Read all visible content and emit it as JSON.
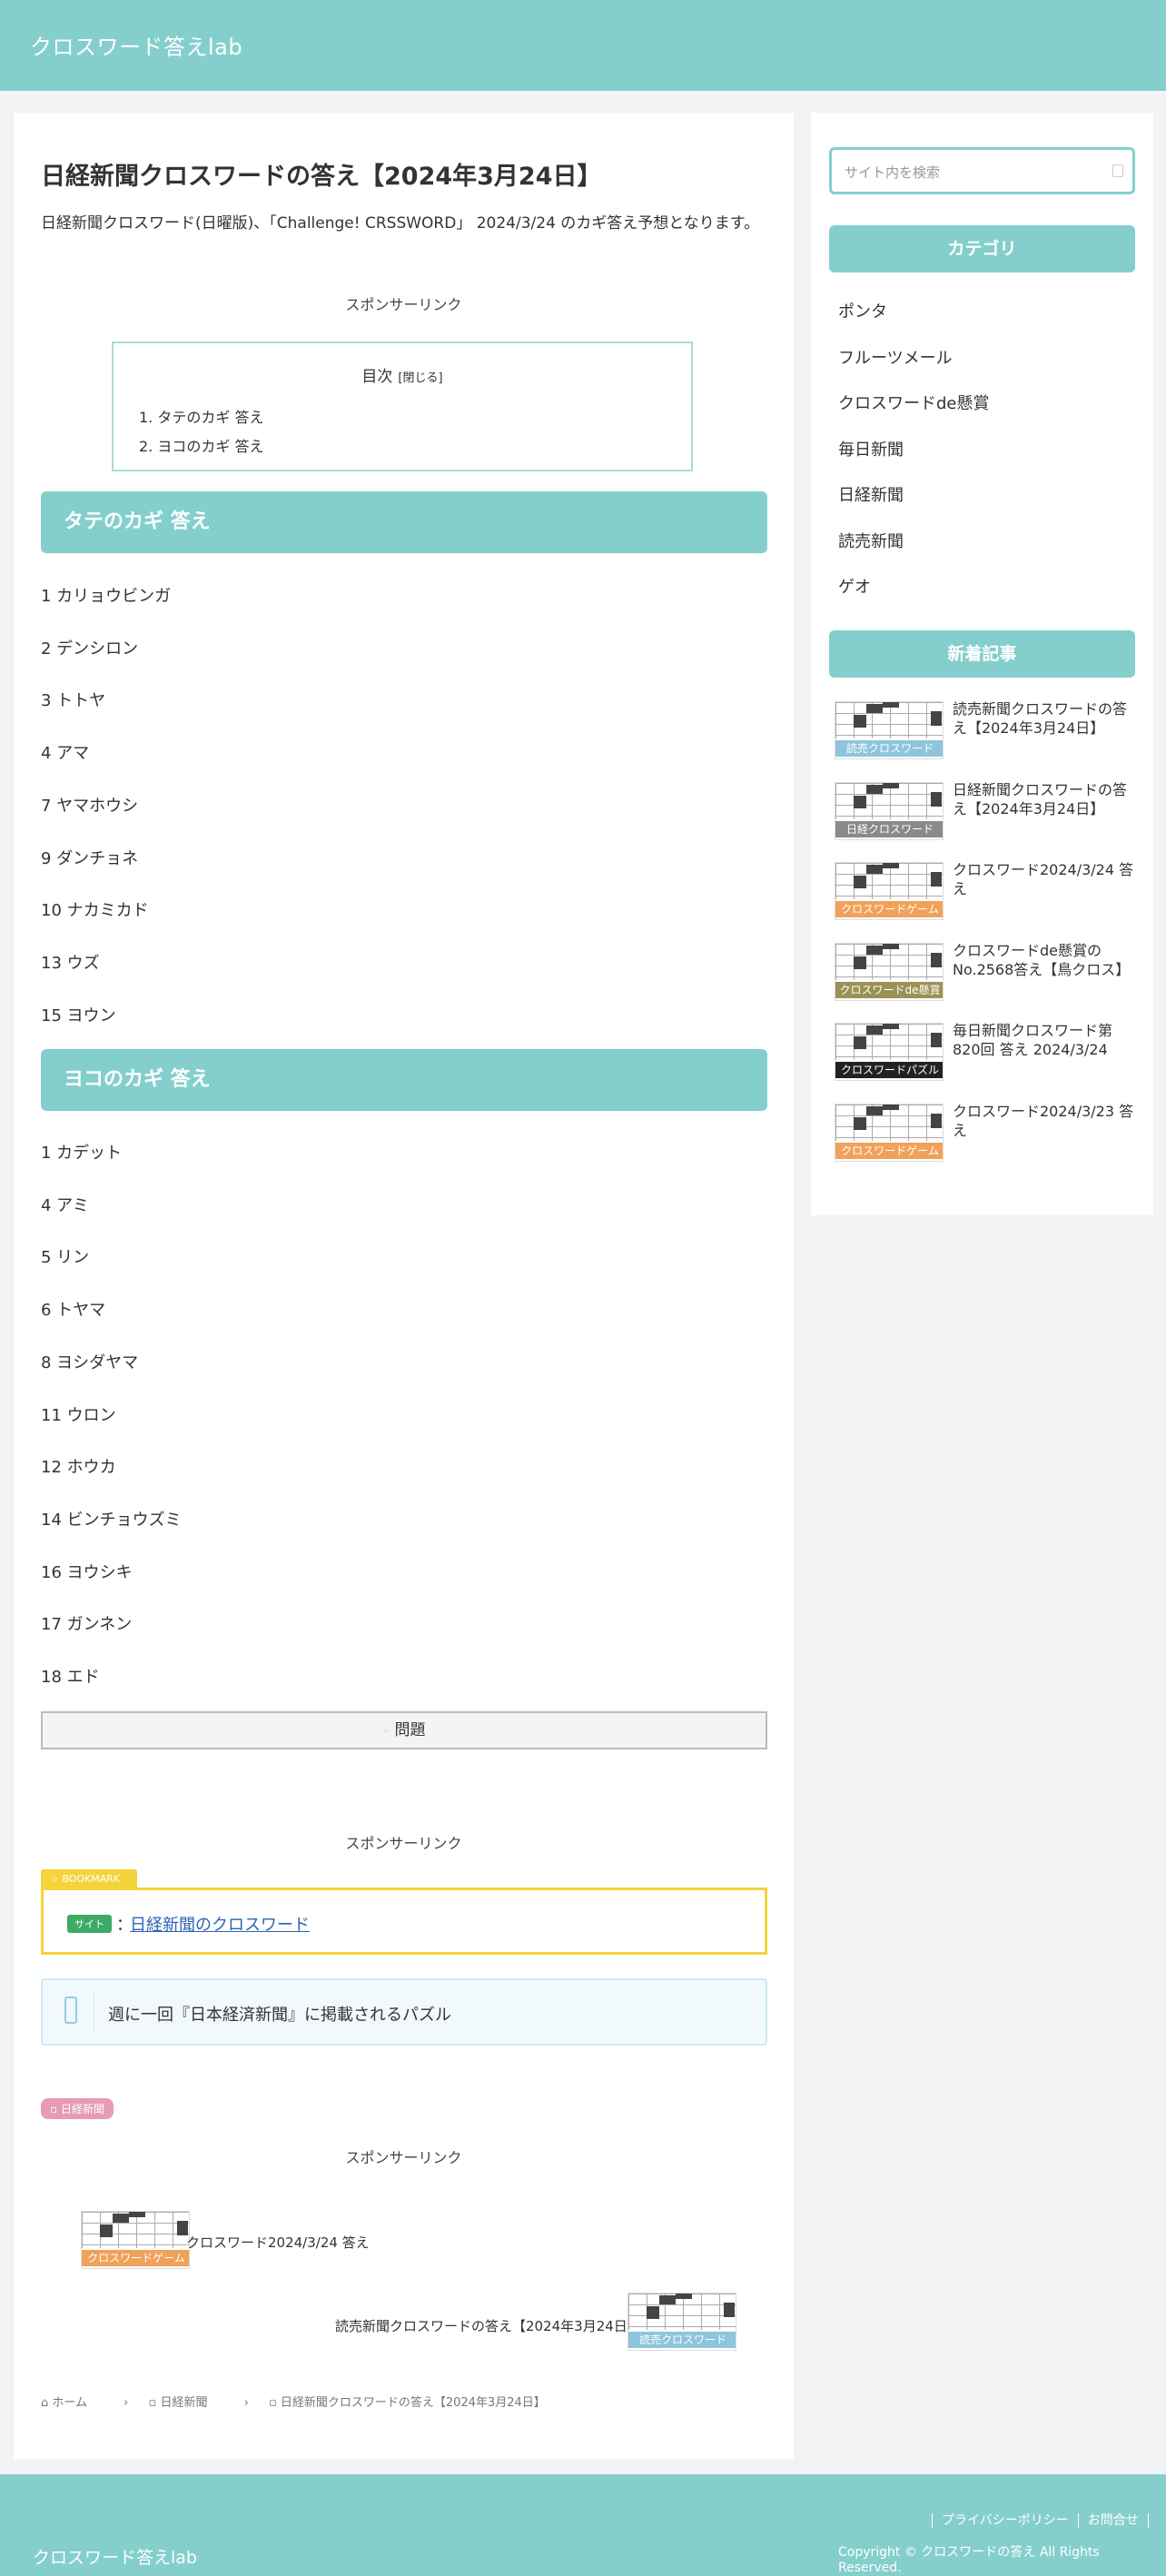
{
  "header": {
    "site_title": "クロスワード答えlab"
  },
  "article": {
    "title": "日経新聞クロスワードの答え【2024年3月24日】",
    "lead": "日経新聞クロスワード(日曜版)、「Challenge! CRSSWORD」 2024/3/24 のカギ答え予想となります。",
    "sponsor_label": "スポンサーリンク",
    "toc": {
      "title": "目次",
      "toggle": "[閉じる]",
      "items": [
        "1. タテのカギ 答え",
        "2. ヨコのカギ 答え"
      ]
    },
    "tate_heading": "タテのカギ 答え",
    "tate": [
      "1 カリョウビンガ",
      "2 デンシロン",
      "3 トトヤ",
      "4 アマ",
      "7 ヤマホウシ",
      "9 ダンチョネ",
      "10 ナカミカド",
      "13 ウズ",
      "15 ヨウン"
    ],
    "yoko_heading": "ヨコのカギ 答え",
    "yoko": [
      "1 カデット",
      "4 アミ",
      "5 リン",
      "6 トヤマ",
      "8 ヨシダヤマ",
      "11 ウロン",
      "12 ホウカ",
      "14 ビンチョウズミ",
      "16 ヨウシキ",
      "17 ガンネン",
      "18 エド"
    ],
    "question_button": "問題",
    "bookmark": {
      "tag": "BOOKMARK",
      "badge": "サイト",
      "colon": "：",
      "link": "日経新聞のクロスワード"
    },
    "info": "週に一回『日本経済新聞』に掲載されるパズル",
    "category_tag": "日経新聞",
    "related": [
      {
        "title": "クロスワード2024/3/24 答え",
        "label": "クロスワードゲーム",
        "label_color": "#f0a25a"
      },
      {
        "title": "読売新聞クロスワードの答え【2024年3月24日】",
        "label": "読売クロスワード",
        "label_color": "#8ec5dc"
      }
    ],
    "breadcrumb": [
      "ホーム",
      "日経新聞",
      "日経新聞クロスワードの答え【2024年3月24日】"
    ]
  },
  "sidebar": {
    "search_placeholder": "サイト内を検索",
    "category_heading": "カテゴリ",
    "categories": [
      "ポンタ",
      "フルーツメール",
      "クロスワードde懸賞",
      "毎日新聞",
      "日経新聞",
      "読売新聞",
      "ゲオ"
    ],
    "new_heading": "新着記事",
    "new_posts": [
      {
        "title": "読売新聞クロスワードの答え【2024年3月24日】",
        "label": "読売クロスワード",
        "label_color": "#8ec5dc"
      },
      {
        "title": "日経新聞クロスワードの答え【2024年3月24日】",
        "label": "日経クロスワード",
        "label_color": "#8a8a8a"
      },
      {
        "title": "クロスワード2024/3/24 答え",
        "label": "クロスワードゲーム",
        "label_color": "#f0a25a"
      },
      {
        "title": "クロスワードde懸賞の No.2568答え【鳥クロス】",
        "label": "クロスワードde懸賞",
        "label_color": "#9c9155"
      },
      {
        "title": "毎日新聞クロスワード第820回 答え 2024/3/24",
        "label": "クロスワードパズル",
        "label_color": "#222222"
      },
      {
        "title": "クロスワード2024/3/23 答え",
        "label": "クロスワードゲーム",
        "label_color": "#f0a25a"
      }
    ]
  },
  "footer": {
    "site_title": "クロスワード答えlab",
    "links": [
      "プライバシーポリシー",
      "お問合せ"
    ],
    "copyright": "Copyright © クロスワードの答え All Rights Reserved."
  }
}
